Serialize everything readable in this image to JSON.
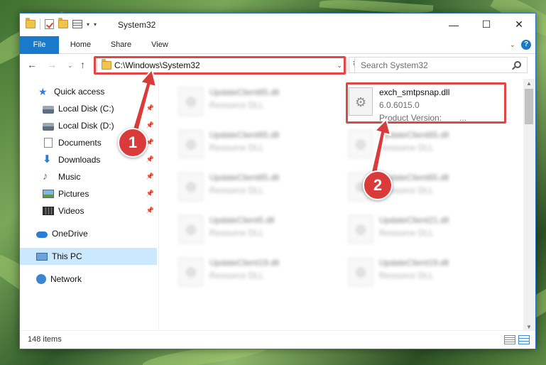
{
  "window": {
    "title": "System32",
    "controls": {
      "minimize": "—",
      "maximize": "☐",
      "close": "✕"
    }
  },
  "ribbon": {
    "tabs": [
      "File",
      "Home",
      "Share",
      "View"
    ]
  },
  "navigation": {
    "back": "←",
    "forward": "→",
    "recent": "⌄",
    "up": "↑",
    "address": "C:\\Windows\\System32",
    "address_dropdown": "⌄",
    "refresh": "↻",
    "search_placeholder": "Search System32"
  },
  "sidebar": {
    "items": [
      {
        "label": "Quick access",
        "icon": "star-icon"
      },
      {
        "label": "Local Disk (C:)",
        "icon": "disk-icon",
        "pinned": true
      },
      {
        "label": "Local Disk (D:)",
        "icon": "disk-icon",
        "pinned": true
      },
      {
        "label": "Documents",
        "icon": "document-icon",
        "pinned": true
      },
      {
        "label": "Downloads",
        "icon": "download-icon",
        "pinned": true
      },
      {
        "label": "Music",
        "icon": "music-icon",
        "pinned": true
      },
      {
        "label": "Pictures",
        "icon": "pictures-icon",
        "pinned": true
      },
      {
        "label": "Videos",
        "icon": "video-icon",
        "pinned": true
      },
      {
        "label": "OneDrive",
        "icon": "cloud-icon"
      },
      {
        "label": "This PC",
        "icon": "computer-icon",
        "selected": true
      },
      {
        "label": "Network",
        "icon": "network-icon"
      }
    ]
  },
  "files": {
    "left_column": [
      {
        "name": "UpdateClient65.dll",
        "type": "Resource DLL"
      },
      {
        "name": "UpdateClient65.dll",
        "type": "Resource DLL"
      },
      {
        "name": "UpdateClient65.dll",
        "type": "Resource DLL"
      },
      {
        "name": "UpdateClient5.dll",
        "type": "Resource DLL"
      },
      {
        "name": "UpdateClient19.dll",
        "type": "Resource DLL"
      }
    ],
    "right_column": [
      {
        "name": "exch_smtpsnap.dll",
        "version": "6.0.6015.0",
        "product": "Product Version:",
        "ellipsis": "..."
      },
      {
        "name": "UpdateClient65.dll",
        "type": "Resource DLL"
      },
      {
        "name": "UpdateClient65.dll",
        "type": "Resource DLL"
      },
      {
        "name": "UpdateClient21.dll",
        "type": "Resource DLL"
      },
      {
        "name": "UpdateClient19.dll",
        "type": "Resource DLL"
      }
    ]
  },
  "status": {
    "item_count": "148 items"
  },
  "callouts": [
    "1",
    "2"
  ],
  "colors": {
    "accent": "#1979ca",
    "highlight": "#e04646",
    "callout": "#d93a3a",
    "selection": "#cce8ff"
  }
}
